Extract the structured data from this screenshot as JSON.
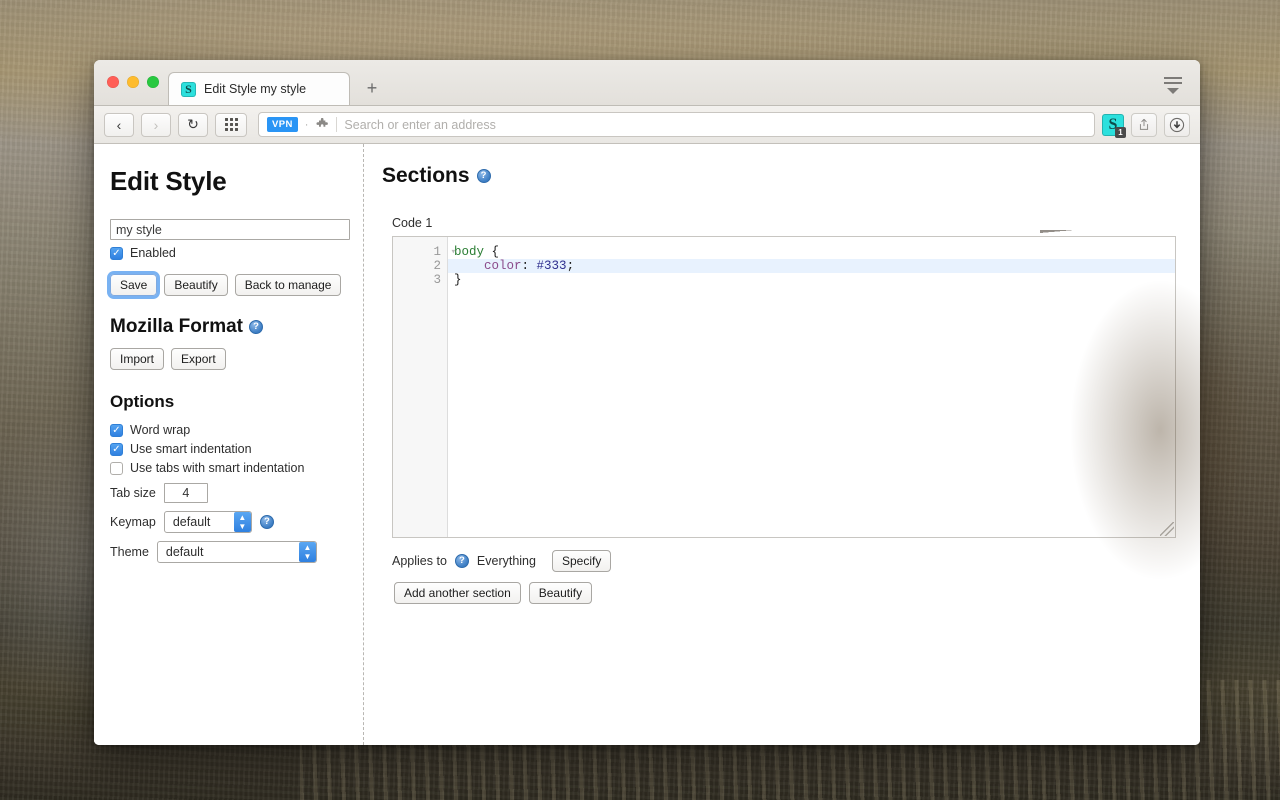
{
  "browser": {
    "window_controls": [
      "close",
      "minimize",
      "maximize"
    ],
    "tab": {
      "title": "Edit Style my style",
      "favicon_letter": "S",
      "favicon_name": "stylish-favicon"
    },
    "new_tab_label": "+",
    "menu_icon": "hamburger-menu-icon",
    "toolbar": {
      "back_icon": "‹",
      "forward_icon": "›",
      "reload_icon": "↻",
      "apps_grid_icon": "grid-icon",
      "vpn_chip": "VPN",
      "extension_puzzle_icon": "puzzle-icon",
      "address_placeholder": "Search or enter an address",
      "address_value": "",
      "stylish_icon_letter": "S",
      "stylish_badge_count": "1",
      "share_icon": "⇧",
      "downloads_icon": "↓"
    }
  },
  "sidebar": {
    "title": "Edit Style",
    "style_name": {
      "value": "my style",
      "placeholder": ""
    },
    "enabled": {
      "label": "Enabled",
      "checked": true
    },
    "actions": [
      {
        "label": "Save",
        "focused": true
      },
      {
        "label": "Beautify",
        "focused": false
      },
      {
        "label": "Back to manage",
        "focused": false
      }
    ],
    "mozilla_format": {
      "heading": "Mozilla Format",
      "help_icon": "help-icon",
      "buttons": [
        {
          "label": "Import"
        },
        {
          "label": "Export"
        }
      ]
    },
    "options": {
      "heading": "Options",
      "checkboxes": [
        {
          "label": "Word wrap",
          "checked": true
        },
        {
          "label": "Use smart indentation",
          "checked": true
        },
        {
          "label": "Use tabs with smart indentation",
          "checked": false
        }
      ],
      "tab_size": {
        "label": "Tab size",
        "value": "4"
      },
      "keymap": {
        "label": "Keymap",
        "value": "default",
        "help_icon": "help-icon"
      },
      "theme": {
        "label": "Theme",
        "value": "default"
      }
    }
  },
  "main": {
    "heading": "Sections",
    "heading_help_icon": "help-icon",
    "section": {
      "code_label": "Code 1",
      "editor": {
        "line_numbers": [
          "1",
          "2",
          "3"
        ],
        "fold_marker": "▾",
        "active_line": 2,
        "lines": [
          [
            {
              "text": "body ",
              "token": "tag"
            },
            {
              "text": "{",
              "token": "plain"
            }
          ],
          [
            {
              "text": "    ",
              "token": "plain"
            },
            {
              "text": "color",
              "token": "prop"
            },
            {
              "text": ": ",
              "token": "plain"
            },
            {
              "text": "#333",
              "token": "val"
            },
            {
              "text": ";",
              "token": "plain"
            }
          ],
          [
            {
              "text": "}",
              "token": "plain"
            }
          ]
        ]
      },
      "applies_to": {
        "label": "Applies to",
        "help_icon": "help-icon",
        "value": "Everything",
        "specify_button": "Specify"
      },
      "bottom_buttons": [
        {
          "label": "Add another section"
        },
        {
          "label": "Beautify"
        }
      ]
    }
  },
  "colors": {
    "accent_blue": "#2f80e0",
    "favicon_cyan": "#2ce0dd",
    "focus_ring": "#62a5f0",
    "code_tag": "#2a7d33",
    "code_prop": "#8b4b8b",
    "code_value": "#2f2f8f",
    "active_line": "#e8f2fe"
  }
}
